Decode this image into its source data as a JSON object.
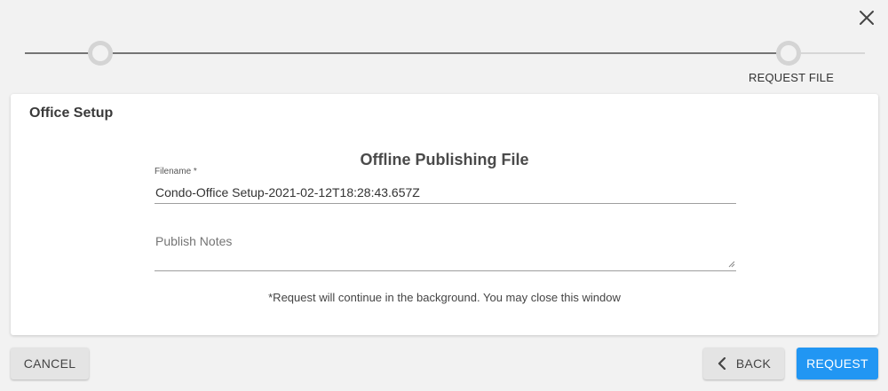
{
  "dialog": {
    "close_icon": "close-icon"
  },
  "stepper": {
    "steps": [
      {
        "label": ""
      },
      {
        "label": "REQUEST FILE"
      }
    ]
  },
  "card": {
    "title": "Office Setup",
    "form_title": "Offline Publishing File",
    "filename": {
      "label": "Filename *",
      "value": "Condo-Office Setup-2021-02-12T18:28:43.657Z"
    },
    "publish_notes": {
      "placeholder": "Publish Notes",
      "value": ""
    },
    "note": "*Request will continue in the background. You may close this window"
  },
  "footer": {
    "cancel_label": "CANCEL",
    "back_label": "BACK",
    "back_icon": "chevron-left-icon",
    "request_label": "REQUEST"
  },
  "colors": {
    "primary": "#2196f3",
    "background": "#f2f2f2",
    "card": "#ffffff"
  }
}
